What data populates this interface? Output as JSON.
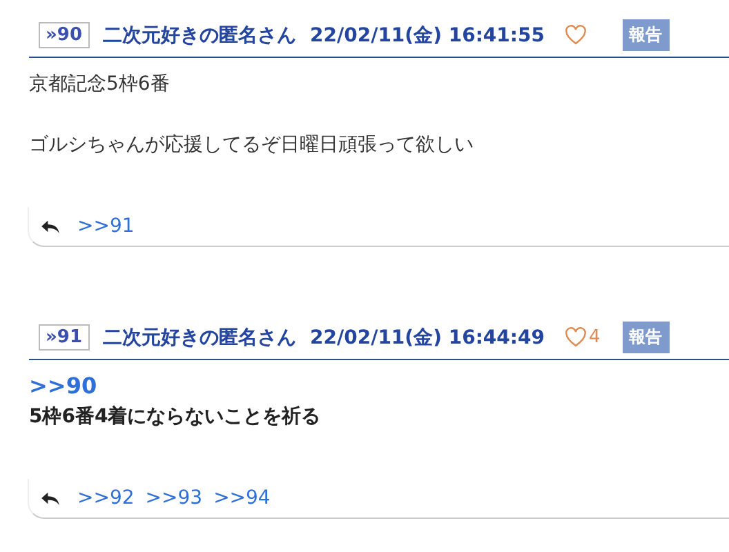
{
  "posts": [
    {
      "number": "»90",
      "author": "二次元好きの匿名さん",
      "date": "22/02/11(金) 16:41:55",
      "report": "報告",
      "paragraphs": [
        {
          "lines": [
            {
              "kind": "text",
              "text": "京都記念5枠6番"
            }
          ]
        },
        {
          "lines": [
            {
              "kind": "text",
              "text": "ゴルシちゃんが応援してるぞ日曜日頑張って欲しい"
            }
          ]
        }
      ],
      "replies": [
        ">>91"
      ]
    },
    {
      "number": "»91",
      "author": "二次元好きの匿名さん",
      "date": "22/02/11(金) 16:44:49",
      "likes": "4",
      "report": "報告",
      "paragraphs": [
        {
          "lines": [
            {
              "kind": "anchor",
              "text": ">>90"
            },
            {
              "kind": "bold",
              "text": "5枠6番4着にならないことを祈る"
            }
          ]
        }
      ],
      "replies": [
        ">>92",
        ">>93",
        ">>94"
      ]
    }
  ]
}
